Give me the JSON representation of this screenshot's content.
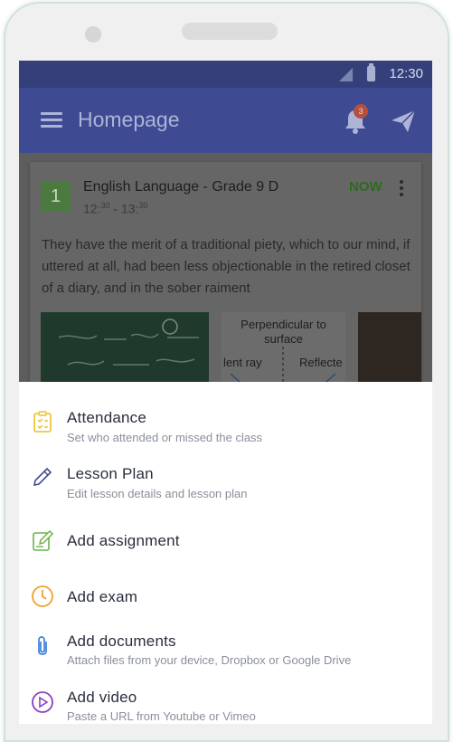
{
  "status_bar": {
    "time": "12:30"
  },
  "app_bar": {
    "title": "Homepage",
    "notification_count": "3"
  },
  "card": {
    "number": "1",
    "course_title": "English Language - Grade 9 D",
    "time_start": "12:",
    "time_start_sup": "30",
    "time_separator": " - 13:",
    "time_end_sup": "30",
    "status_label": "NOW",
    "description": "They have the merit of a traditional piety, which to our mind, if uttered at all, had been less objectionable in the retired closet of a diary, and in the sober raiment",
    "thumbnail2": {
      "title": "Perpendicular to surface",
      "label_left": "lent ray",
      "label_right": "Reflecte"
    }
  },
  "menu": {
    "items": [
      {
        "title": "Attendance",
        "subtitle": "Set who attended or missed the class",
        "icon": "clipboard-check-icon"
      },
      {
        "title": "Lesson Plan",
        "subtitle": "Edit lesson details and lesson plan",
        "icon": "pencil-icon"
      },
      {
        "title": "Add assignment",
        "subtitle": "",
        "icon": "edit-document-icon"
      },
      {
        "title": "Add exam",
        "subtitle": "",
        "icon": "clock-icon"
      },
      {
        "title": "Add documents",
        "subtitle": "Attach files from your device, Dropbox or Google Drive",
        "icon": "paperclip-icon"
      },
      {
        "title": "Add video",
        "subtitle": "Paste a URL from Youtube or Vimeo",
        "icon": "play-circle-icon"
      }
    ]
  },
  "colors": {
    "app_bar": "#3e4b93",
    "attendance_icon": "#e6c12a",
    "lesson_plan_icon": "#3e4b93",
    "assignment_icon": "#6bb34a",
    "exam_icon": "#f0a12b",
    "documents_icon": "#3a7fd8",
    "video_icon": "#8a3fbf"
  }
}
